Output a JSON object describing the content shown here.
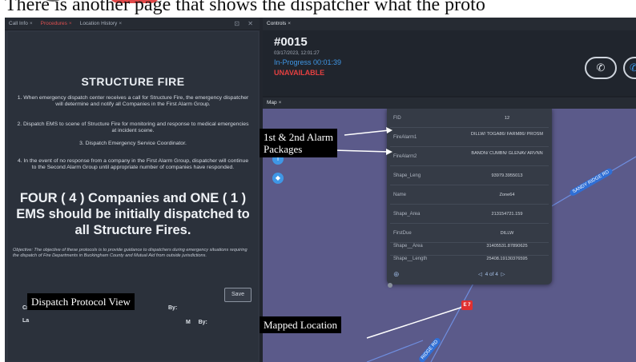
{
  "caption": "There is another page that shows the dispatcher what the proto",
  "left_panel": {
    "tabs": [
      {
        "label": "Call Info",
        "close": "×",
        "active": false
      },
      {
        "label": "Procedures",
        "close": "×",
        "active": true
      },
      {
        "label": "Location History",
        "close": "×",
        "active": false
      }
    ],
    "window_controls": "⊡ ✕",
    "title": "STRUCTURE FIRE",
    "steps": [
      "1. When emergency dispatch center receives a call for Structure Fire, the emergency dispatcher will determine and notify all Companies in the First Alarm Group.",
      "2. Dispatch EMS to scene of Structure Fire for monitoring and response to medical emergencies at incident scene.",
      "3. Dispatch Emergency Service Coordinator.",
      "4. In the event of no response from a company in the First Alarm Group, dispatcher will continue to the Second Alarm Group until appropriate number of companies have responded."
    ],
    "headline": "FOUR ( 4 ) Companies and ONE ( 1 ) EMS should be initially dispatched to all Structure Fires.",
    "objective": "Objective: The objective of these protocols is to provide guidance to dispatchers during emergency situations requiring the dispatch of Fire Departments in Buckingham County and Mutual Aid from outside jurisdictions.",
    "save_label": "Save",
    "meta_created": "Cr",
    "meta_by1": "By:",
    "meta_updated": "La",
    "meta_time": "M",
    "meta_by2": "By:"
  },
  "callouts": {
    "alarm_packages_1": "1st & 2nd Alarm",
    "alarm_packages_2": "Packages",
    "protocol_view": "Dispatch Protocol View",
    "mapped_location": "Mapped Location"
  },
  "right_panel": {
    "tabs": [
      {
        "label": "Controls",
        "close": "×"
      }
    ],
    "incident": {
      "id": "#0015",
      "date": "03/17/2023, 12:01:27",
      "progress": "In-Progress 00:01:39",
      "status": "UNAVAILABLE"
    },
    "phone_icon": "✆",
    "map_tabs": [
      {
        "label": "Map",
        "close": "×"
      }
    ],
    "map_controls": [
      "+",
      "i",
      "◆"
    ],
    "road_labels": [
      "SANDY RIDGE RD",
      "RIDGE RD"
    ],
    "popup": {
      "rows": [
        {
          "key": "FID",
          "value": "12"
        },
        {
          "key": "FireAlarm1",
          "value": "DILLW/ TOGA86/ FARM86/ PROSM"
        },
        {
          "key": "FireAlarm2",
          "value": "BANDN/ CUMBN/ GLENAV ARVNN"
        },
        {
          "key": "Shape_Leng",
          "value": "93979.3955013"
        },
        {
          "key": "Name",
          "value": "Zone64"
        },
        {
          "key": "Shape_Area",
          "value": "213154721.159"
        },
        {
          "key": "FirstDue",
          "value": "DILLW"
        },
        {
          "key": "Shape__Area",
          "value": "31405531.87890625"
        },
        {
          "key": "Shape__Length",
          "value": "25408.19130376595"
        }
      ],
      "zoom_icon": "⊕",
      "pager_prev": "◁",
      "pager_text": "4 of 4",
      "pager_next": "▷"
    },
    "marker_label": "E 7"
  }
}
